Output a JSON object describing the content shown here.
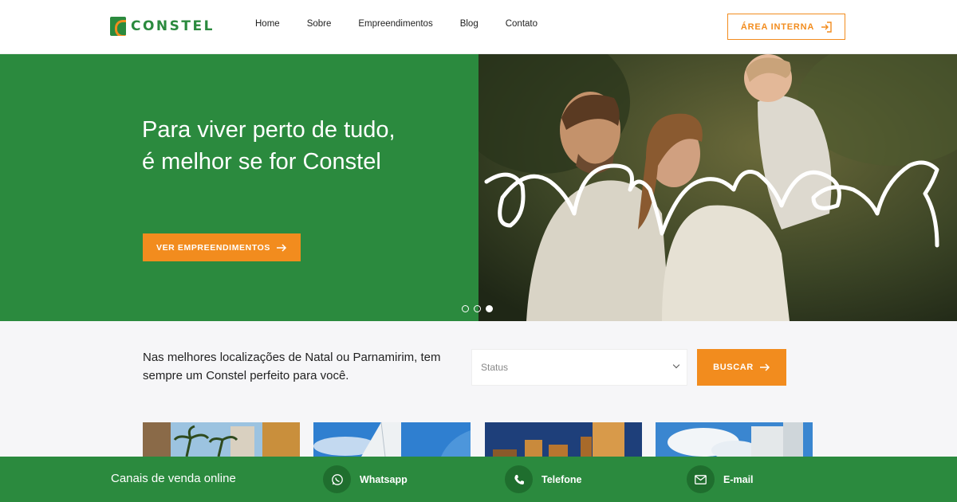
{
  "header": {
    "brand": "CONSTEL",
    "nav": [
      {
        "label": "Home"
      },
      {
        "label": "Sobre"
      },
      {
        "label": "Empreendimentos"
      },
      {
        "label": "Blog"
      },
      {
        "label": "Contato"
      }
    ],
    "area_interna_label": "ÁREA INTERNA",
    "area_interna_icon": "login-arrow-icon"
  },
  "hero": {
    "title": "Para viver perto de tudo, é melhor se for Constel",
    "cta_label": "VER EMPREENDIMENTOS",
    "cta_icon": "arrow-right-icon",
    "script_word": "viver",
    "slides_total": 3,
    "active_slide": 3,
    "image": "family-photo",
    "green": "#2b8a3e",
    "orange": "#f28c1e"
  },
  "search": {
    "tagline": "Nas melhores localizações de Natal ou Parnamirim, tem sempre um Constel perfeito para você.",
    "status_placeholder": "Status",
    "buscar_label": "BUSCAR"
  },
  "listings": [
    {
      "image": "building-palms-photo"
    },
    {
      "image": "tower-blue-sky-photo"
    },
    {
      "image": "buildings-dusk-photo"
    },
    {
      "image": "tower-clouds-photo"
    }
  ],
  "footer": {
    "title": "Canais de venda online",
    "channels": [
      {
        "label": "Whatsapp",
        "icon": "whatsapp-icon"
      },
      {
        "label": "Telefone",
        "icon": "phone-icon"
      },
      {
        "label": "E-mail",
        "icon": "mail-icon"
      }
    ]
  }
}
